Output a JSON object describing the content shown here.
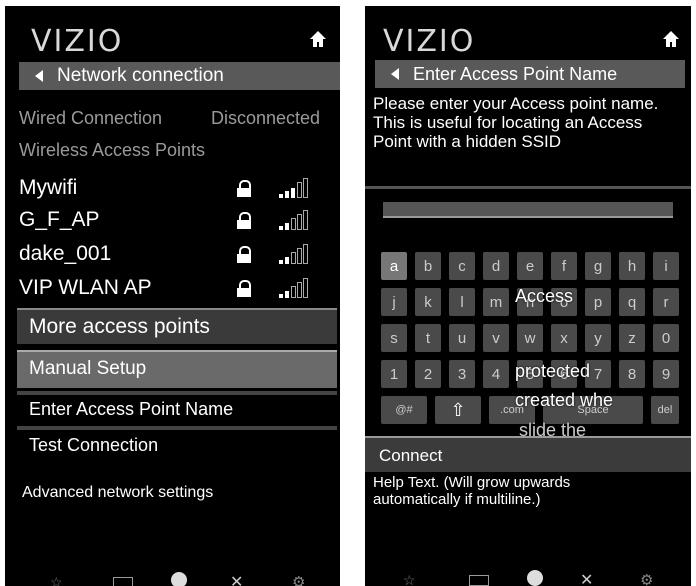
{
  "left": {
    "logo": "VIZIO",
    "header": "Network connection",
    "wired_label": "Wired Connection",
    "wired_status": "Disconnected",
    "wireless_label": "Wireless Access Points",
    "networks": [
      {
        "name": "Mywifi",
        "signal": 3
      },
      {
        "name": "G_F_AP",
        "signal": 2
      },
      {
        "name": "dake_001",
        "signal": 2
      },
      {
        "name": "VIP WLAN AP",
        "signal": 2
      }
    ],
    "more": "More access points",
    "manual": "Manual Setup",
    "enter_ap": "Enter Access Point Name",
    "test": "Test Connection",
    "advanced": "Advanced network settings"
  },
  "right": {
    "logo": "VIZIO",
    "header": "Enter Access Point Name",
    "instructions": "Please enter your Access point name. This is useful for locating an Access Point with a hidden SSID",
    "input_value": "",
    "keys_row1": [
      "a",
      "b",
      "c",
      "d",
      "e",
      "f",
      "g",
      "h",
      "i"
    ],
    "keys_row2": [
      "j",
      "k",
      "l",
      "m",
      "n",
      "o",
      "p",
      "q",
      "r"
    ],
    "keys_row3": [
      "s",
      "t",
      "u",
      "v",
      "w",
      "x",
      "y",
      "z",
      "0"
    ],
    "keys_row4": [
      "1",
      "2",
      "3",
      "4",
      "5",
      "6",
      "7",
      "8",
      "9"
    ],
    "key_sym": "@#",
    "key_shift": "⇧",
    "key_com": ".com",
    "key_space": "Space",
    "key_del": "del",
    "overlay_1": "Access",
    "overlay_2": "protected",
    "overlay_3": "created whe",
    "overlay_4": "slide the",
    "connect": "Connect",
    "help_text": "Help Text. (Will grow upwards automatically if multiline.)"
  }
}
